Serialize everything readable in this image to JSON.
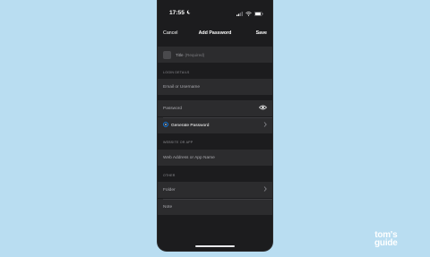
{
  "status_bar": {
    "time": "17:55"
  },
  "nav": {
    "cancel": "Cancel",
    "title": "Add Password",
    "save": "Save"
  },
  "title_field": {
    "label": "Title",
    "hint": "(Required)"
  },
  "sections": {
    "login": "LOGIN DETAILS",
    "website": "WEBSITE OR APP",
    "other": "OTHER"
  },
  "fields": {
    "username_placeholder": "Email or Username",
    "password_placeholder": "Password",
    "generate": "Generate Password",
    "website_placeholder": "Web Address or App Name",
    "folder": "Folder",
    "note": "Note"
  },
  "watermark": {
    "line1": "tom's",
    "line2": "guide"
  },
  "colors": {
    "background": "#b9ddf1",
    "panel": "#1c1c1e",
    "cell": "#2c2c2e",
    "accent": "#0a84ff"
  },
  "icons": [
    "moon-icon",
    "signal-icon",
    "wifi-icon",
    "battery-icon",
    "eye-icon",
    "key-icon",
    "chevron-right-icon"
  ]
}
